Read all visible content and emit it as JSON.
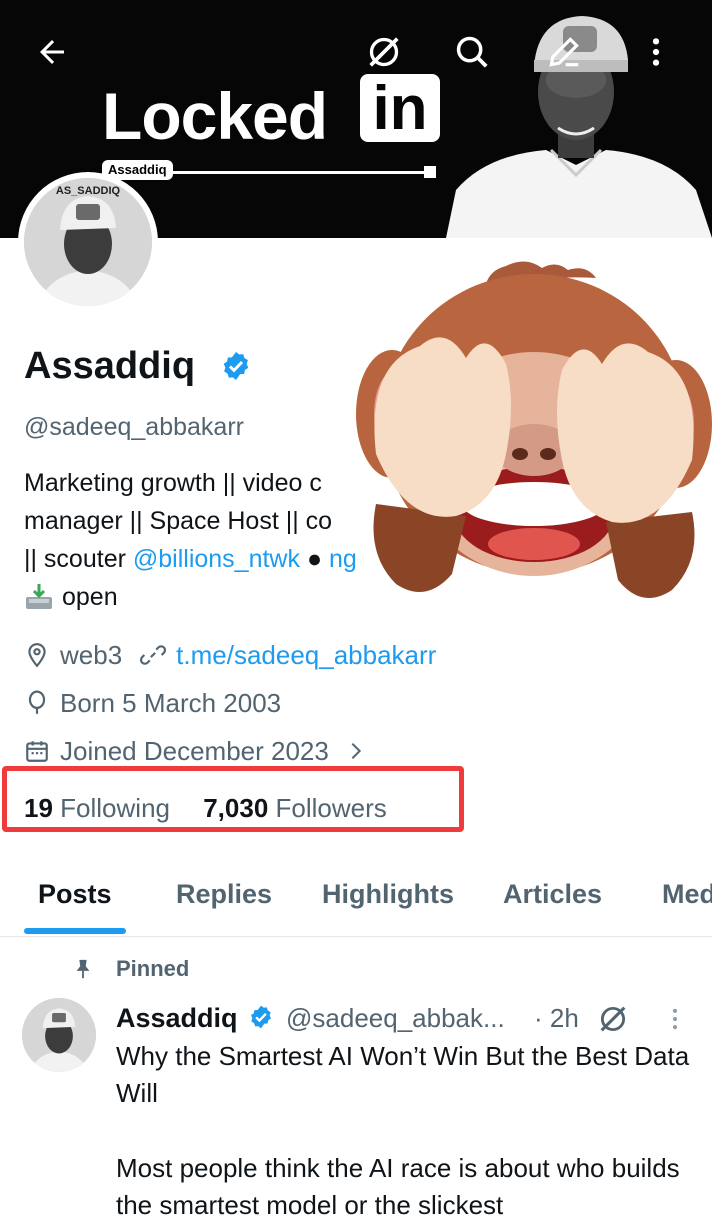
{
  "banner": {
    "title_text": "Locked",
    "title_in": "in",
    "tag": "Assaddiq"
  },
  "header_icons": [
    "back-arrow-icon",
    "grok-icon",
    "search-icon",
    "edit-icon",
    "more-vertical-icon"
  ],
  "profile": {
    "avatar_caption": "AS_SADDIQ",
    "name": "Assaddiq",
    "handle": "@sadeeq_abbakarr",
    "bio_line1": "Marketing growth || video c",
    "bio_line2": "manager || Space Host || co",
    "bio_line3_prefix": "|| scouter ",
    "bio_line3_link": "@billions_ntwk",
    "bio_line3_tail": " ● ",
    "bio_line3_tail_link": "ng",
    "bio_line4": "open",
    "location": "web3",
    "website": "t.me/sadeeq_abbakarr",
    "born": "Born 5 March 2003",
    "joined": "Joined December 2023",
    "following_count": "19",
    "following_label": "Following",
    "followers_count": "7,030",
    "followers_label": "Followers"
  },
  "tabs": [
    {
      "label": "Posts"
    },
    {
      "label": "Replies"
    },
    {
      "label": "Highlights"
    },
    {
      "label": "Articles"
    },
    {
      "label": "Med"
    }
  ],
  "pinned_post": {
    "pinned_label": "Pinned",
    "name": "Assaddiq",
    "handle": "@sadeeq_abbak...",
    "time": "· 2h",
    "title": "Why the Smartest AI Won’t Win But the Best Data Will",
    "body": "Most people think the AI race is about who builds the smartest model or the slickest"
  },
  "colors": {
    "accent": "#1d9bf0",
    "text_primary": "#0f1419",
    "text_secondary": "#536471",
    "highlight_box": "#ef3b3b",
    "banner_bg": "#060606"
  }
}
